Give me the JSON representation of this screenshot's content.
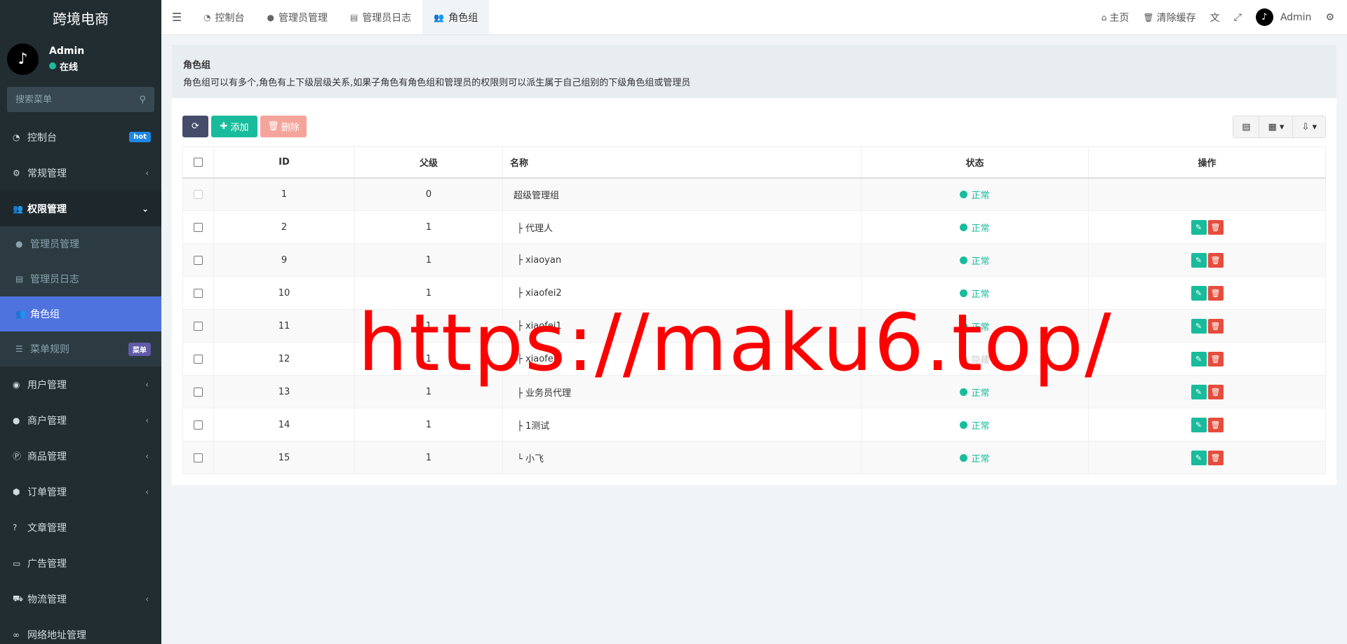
{
  "sidebar": {
    "brand": "跨境电商",
    "user": {
      "name": "Admin",
      "status": "在线"
    },
    "search_placeholder": "搜索菜单",
    "items": [
      {
        "label": "控制台",
        "icon": "dashboard-icon",
        "badge": "hot"
      },
      {
        "label": "常规管理",
        "icon": "cogs-icon"
      },
      {
        "label": "权限管理",
        "icon": "users-icon"
      }
    ],
    "subitems": [
      {
        "label": "管理员管理",
        "icon": "user-icon"
      },
      {
        "label": "管理员日志",
        "icon": "list-alt-icon"
      },
      {
        "label": "角色组",
        "icon": "group-icon"
      },
      {
        "label": "菜单规则",
        "icon": "bars-icon",
        "badge": "菜单"
      }
    ],
    "items_after": [
      {
        "label": "用户管理",
        "icon": "user-circle-icon"
      },
      {
        "label": "商户管理",
        "icon": "apple-icon"
      },
      {
        "label": "商品管理",
        "icon": "product-p-icon"
      },
      {
        "label": "订单管理",
        "icon": "cube-icon"
      },
      {
        "label": "文章管理",
        "icon": "question-circle-icon"
      },
      {
        "label": "广告管理",
        "icon": "credit-card-icon"
      },
      {
        "label": "物流管理",
        "icon": "truck-icon"
      },
      {
        "label": "网络地址管理",
        "icon": "link-icon"
      }
    ]
  },
  "topbar": {
    "tabs": [
      {
        "label": "控制台",
        "icon": "dashboard-icon"
      },
      {
        "label": "管理员管理",
        "icon": "user-icon"
      },
      {
        "label": "管理员日志",
        "icon": "list-alt-icon"
      },
      {
        "label": "角色组",
        "icon": "group-icon"
      }
    ],
    "right": {
      "home": "主页",
      "clear_cache": "清除缓存",
      "user": "Admin"
    }
  },
  "panel": {
    "title": "角色组",
    "description": "角色组可以有多个,角色有上下级层级关系,如果子角色有角色组和管理员的权限则可以派生属于自己组别的下级角色组或管理员"
  },
  "toolbar": {
    "add_label": "添加",
    "delete_label": "删除"
  },
  "table": {
    "columns": [
      "ID",
      "父级",
      "名称",
      "状态",
      "操作"
    ],
    "rows": [
      {
        "id": "1",
        "pid": "0",
        "name": "超级管理组",
        "status": "正常"
      },
      {
        "id": "2",
        "pid": "1",
        "name": "├ 代理人",
        "status": "正常"
      },
      {
        "id": "9",
        "pid": "1",
        "name": "├ xiaoyan",
        "status": "正常"
      },
      {
        "id": "10",
        "pid": "1",
        "name": "├ xiaofei2",
        "status": "正常"
      },
      {
        "id": "11",
        "pid": "1",
        "name": "├ xiaofei1",
        "status": "正常"
      },
      {
        "id": "12",
        "pid": "1",
        "name": "├ xiaofei3",
        "status": "隐藏"
      },
      {
        "id": "13",
        "pid": "1",
        "name": "├ 业务员代理",
        "status": "正常"
      },
      {
        "id": "14",
        "pid": "1",
        "name": "├ 1测试",
        "status": "正常"
      },
      {
        "id": "15",
        "pid": "1",
        "name": "└ 小飞",
        "status": "正常"
      }
    ]
  },
  "watermark": "https://maku6.top/",
  "colors": {
    "accent": "#18bc9c",
    "sidebar": "#222d32",
    "active": "#4e73df",
    "danger": "#e74c3c"
  }
}
